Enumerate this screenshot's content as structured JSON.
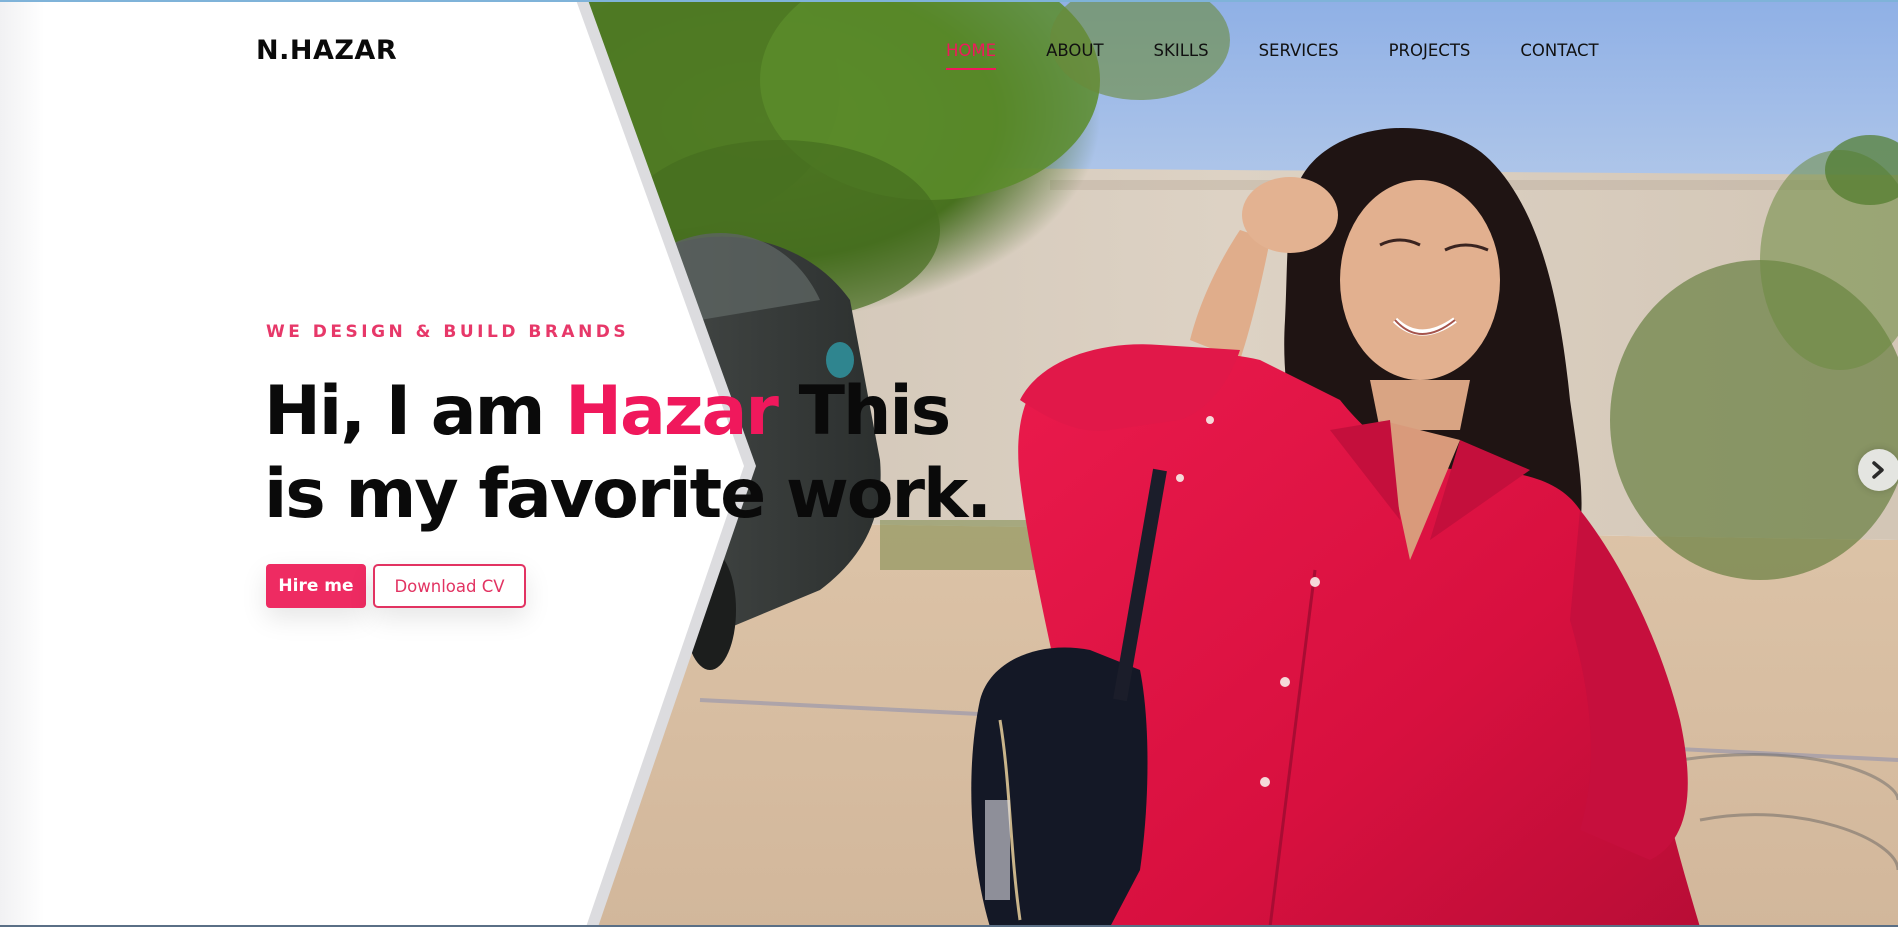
{
  "header": {
    "logo": "N.HAZAR",
    "nav": [
      {
        "label": "HOME",
        "active": true
      },
      {
        "label": "ABOUT",
        "active": false
      },
      {
        "label": "SKILLS",
        "active": false
      },
      {
        "label": "SERVICES",
        "active": false
      },
      {
        "label": "PROJECTS",
        "active": false
      },
      {
        "label": "CONTACT",
        "active": false
      }
    ]
  },
  "hero": {
    "eyebrow": "WE DESIGN & BUILD BRANDS",
    "headline_before": "Hi, I am ",
    "headline_name": "Hazar",
    "headline_after": " This is my favorite work.",
    "primary_button": "Hire me",
    "secondary_button": "Download CV",
    "slider_next_icon": "chevron-right-icon",
    "background_image": "hero-portrait-photo"
  },
  "colors": {
    "accent": "#f0185c",
    "button": "#ee2b62",
    "text": "#0a0a0a",
    "shirt": "#e51446"
  }
}
